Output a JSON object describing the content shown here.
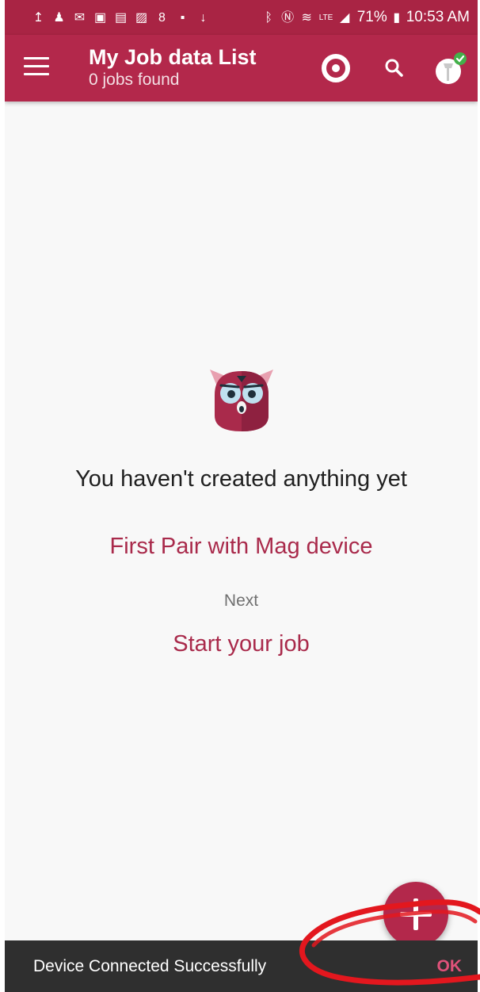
{
  "status_bar": {
    "battery": "71%",
    "time": "10:53 AM",
    "left_icons": [
      "upload-icon",
      "person-icon",
      "mail-icon",
      "photo-mail-icon",
      "calendar-icon",
      "image-icon",
      "lock-icon",
      "video-icon",
      "download-icon"
    ],
    "right_icons": [
      "bluetooth-icon",
      "nfc-icon",
      "wifi-icon",
      "lte-icon",
      "signal-icon",
      "battery-icon"
    ]
  },
  "app_bar": {
    "title": "My Job data List",
    "subtitle": "0 jobs found",
    "actions": [
      "sync-icon",
      "search-icon",
      "device-connected-icon"
    ]
  },
  "empty_state": {
    "title": "You haven't created anything yet",
    "primary_link": "First Pair with Mag device",
    "next_label": "Next",
    "secondary_link": "Start your job"
  },
  "snackbar": {
    "message": "Device Connected Successfully",
    "action": "OK"
  },
  "colors": {
    "primary": "#b3284b",
    "status_bar": "#a92444",
    "accent_text": "#a92a4b",
    "snackbar_bg": "#2f2f2f",
    "annotation": "#e3171e"
  }
}
